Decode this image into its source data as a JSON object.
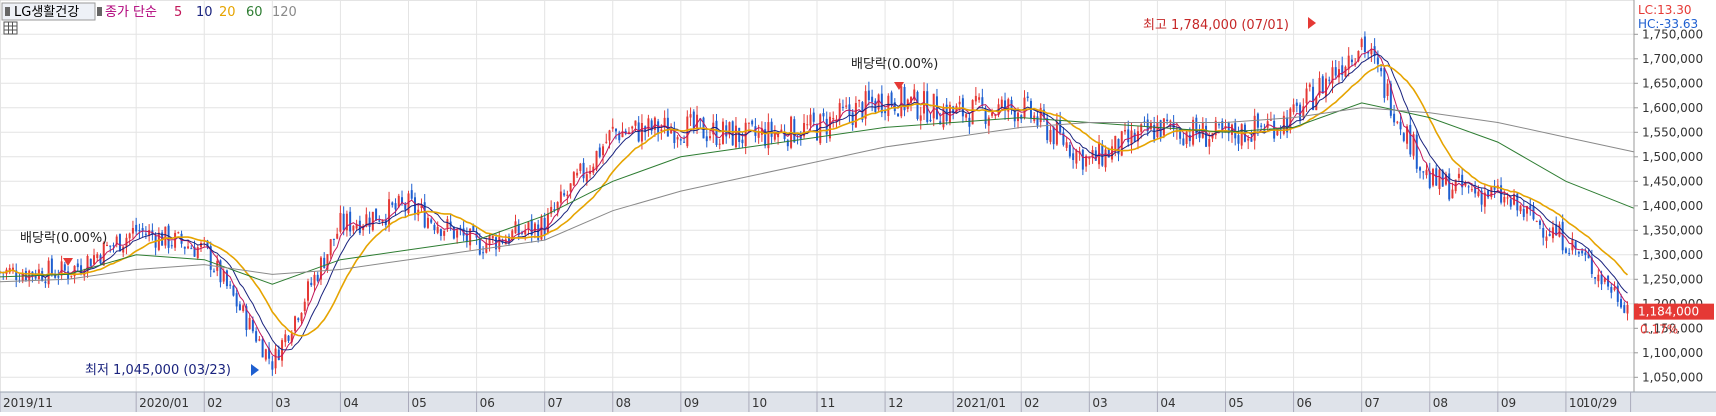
{
  "header": {
    "stock_name": "LG생활건강",
    "ma_label": "종가 단순",
    "periods": [
      {
        "label": "5",
        "color": "#c2185b"
      },
      {
        "label": "10",
        "color": "#1a237e"
      },
      {
        "label": "20",
        "color": "#e6a400"
      },
      {
        "label": "60",
        "color": "#2e7d32"
      },
      {
        "label": "120",
        "color": "#8a8a8a"
      }
    ]
  },
  "panel": {
    "lc": "LC:13.30",
    "hc": "HC:-33.63",
    "current_price": "1,184,000",
    "change_pct": "0.17%"
  },
  "annotations": {
    "high": "최고 1,784,000 (07/01)",
    "low": "최저 1,045,000 (03/23)",
    "dividend_1": "배당락(0.00%)",
    "dividend_2": "배당락(0.00%)"
  },
  "chart_data": {
    "type": "candlestick",
    "ylim": [
      1020000,
      1820000
    ],
    "y_ticks": [
      1050000,
      1100000,
      1150000,
      1200000,
      1250000,
      1300000,
      1350000,
      1400000,
      1450000,
      1500000,
      1550000,
      1600000,
      1650000,
      1700000,
      1750000
    ],
    "y_tick_labels": [
      "1,050,000",
      "1,100,000",
      "1,150,000",
      "1,200,000",
      "1,250,000",
      "1,300,000",
      "1,350,000",
      "1,400,000",
      "1,450,000",
      "1,500,000",
      "1,550,000",
      "1,600,000",
      "1,650,000",
      "1,700,000",
      "1,750,000"
    ],
    "x_labels": [
      "2019/11",
      "2020/01",
      "02",
      "03",
      "04",
      "05",
      "06",
      "07",
      "08",
      "09",
      "10",
      "11",
      "12",
      "2021/01",
      "02",
      "03",
      "04",
      "05",
      "06",
      "07",
      "08",
      "09",
      "10",
      "10/29"
    ],
    "x_label_month_index": [
      0,
      2,
      3,
      4,
      5,
      6,
      7,
      8,
      9,
      10,
      11,
      12,
      13,
      14,
      15,
      16,
      17,
      18,
      19,
      20,
      21,
      22,
      23,
      23.95
    ],
    "month_count": 24,
    "monthly_close": [
      1265000,
      1265000,
      1350000,
      1310000,
      1080000,
      1360000,
      1400000,
      1320000,
      1360000,
      1550000,
      1560000,
      1540000,
      1560000,
      1620000,
      1590000,
      1600000,
      1490000,
      1560000,
      1540000,
      1580000,
      1740000,
      1450000,
      1420000,
      1330000,
      1184000
    ],
    "ma60_monthly": [
      1255000,
      1260000,
      1300000,
      1290000,
      1240000,
      1290000,
      1310000,
      1330000,
      1380000,
      1450000,
      1500000,
      1520000,
      1540000,
      1560000,
      1570000,
      1580000,
      1570000,
      1560000,
      1550000,
      1560000,
      1610000,
      1580000,
      1530000,
      1450000,
      1395000
    ],
    "ma120_monthly": [
      1245000,
      1250000,
      1270000,
      1280000,
      1260000,
      1270000,
      1290000,
      1310000,
      1330000,
      1390000,
      1430000,
      1460000,
      1490000,
      1520000,
      1540000,
      1560000,
      1570000,
      1570000,
      1570000,
      1580000,
      1600000,
      1590000,
      1570000,
      1540000,
      1510000
    ],
    "last_value": 1184000,
    "high": {
      "value": 1784000,
      "date": "07/01"
    },
    "low": {
      "value": 1045000,
      "date": "03/23"
    },
    "grid": true,
    "up_color": "#e53935",
    "down_color": "#1e5fd0"
  }
}
